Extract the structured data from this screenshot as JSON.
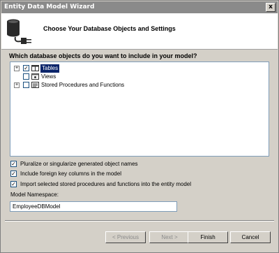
{
  "window": {
    "title": "Entity Data Model Wizard",
    "close_glyph": "x"
  },
  "header": {
    "title": "Choose Your Database Objects and Settings",
    "icon": "database-plug-icon"
  },
  "question": "Which database objects do you want to include in your model?",
  "tree": [
    {
      "label": "Tables",
      "checked": true,
      "expand": "+",
      "selected": true,
      "icon": "table-icon"
    },
    {
      "label": "Views",
      "checked": false,
      "expand": "",
      "selected": false,
      "icon": "view-icon"
    },
    {
      "label": "Stored Procedures and Functions",
      "checked": false,
      "expand": "+",
      "selected": false,
      "icon": "procedure-icon"
    }
  ],
  "options": [
    {
      "label": "Pluralize or singularize generated object names",
      "checked": true
    },
    {
      "label": "Include foreign key columns in the model",
      "checked": true
    },
    {
      "label": "Import selected stored procedures and functions into the entity model",
      "checked": true
    }
  ],
  "namespace": {
    "label": "Model Namespace:",
    "value": "EmployeeDBModel"
  },
  "buttons": {
    "previous": "< Previous",
    "next": "Next >",
    "finish": "Finish",
    "cancel": "Cancel"
  },
  "check_glyph": "✓"
}
